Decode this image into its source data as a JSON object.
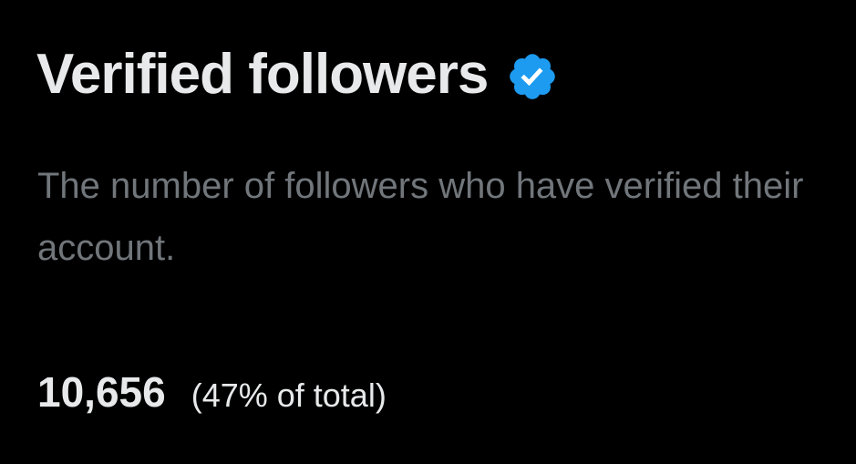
{
  "title": "Verified followers",
  "verified_icon": "verified-badge-icon",
  "description": "The number of followers who have verified their account.",
  "stats": {
    "count": "10,656",
    "percent_of_total": "(47% of total)"
  },
  "colors": {
    "background": "#000000",
    "primary_text": "#e7e9ea",
    "secondary_text": "#71767b",
    "verified_blue": "#1d9bf0"
  }
}
